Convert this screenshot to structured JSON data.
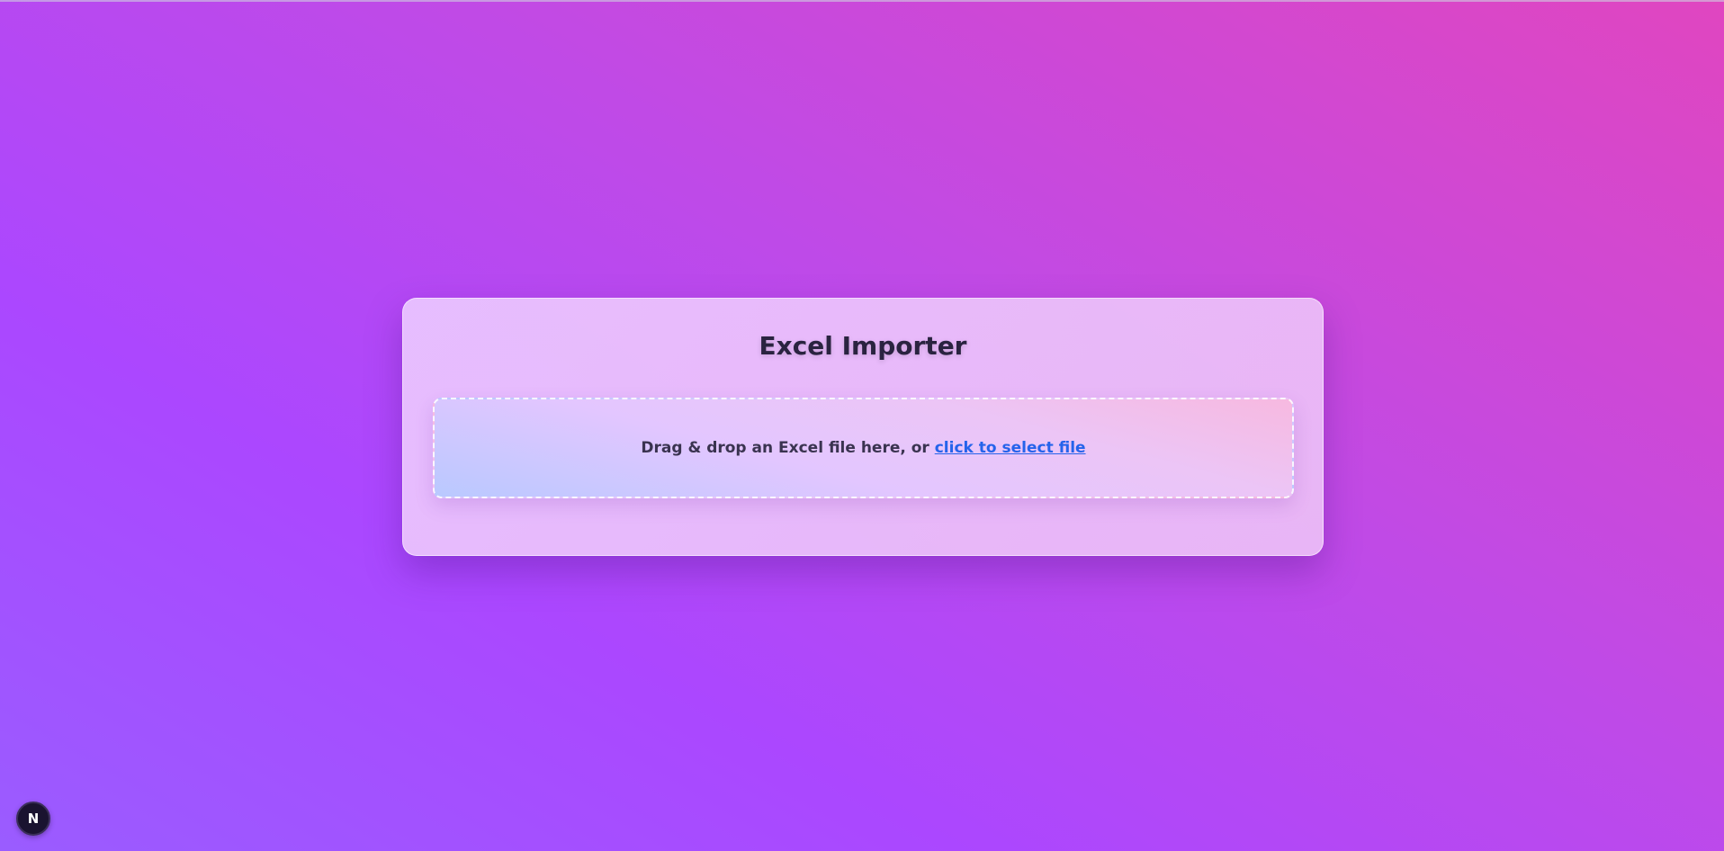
{
  "page": {
    "title": "Excel Importer"
  },
  "dropzone": {
    "text": "Drag & drop an Excel file here, or ",
    "link_label": "click to select file"
  },
  "badge": {
    "icon": "nextjs-logo-icon",
    "letter": "N"
  },
  "colors": {
    "link": "#2563eb",
    "title": "#2a2340",
    "badge_bg": "#1a1330"
  }
}
